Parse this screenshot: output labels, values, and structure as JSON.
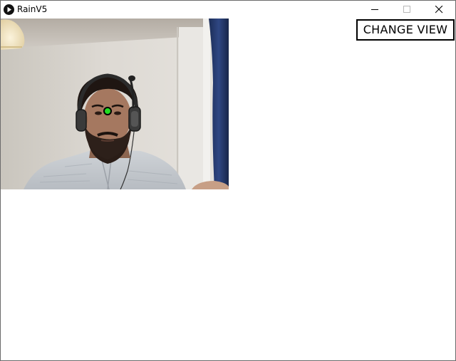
{
  "window": {
    "title": "RainV5",
    "app_icon": "play-circle-icon",
    "controls": {
      "minimize_icon": "minimize-icon",
      "maximize_icon": "maximize-icon",
      "close_icon": "close-icon"
    }
  },
  "toolbar": {
    "change_view_label": "CHANGE VIEW"
  },
  "camera": {
    "tracking_marker_color": "#22dd22",
    "tracked_feature": "nose"
  }
}
